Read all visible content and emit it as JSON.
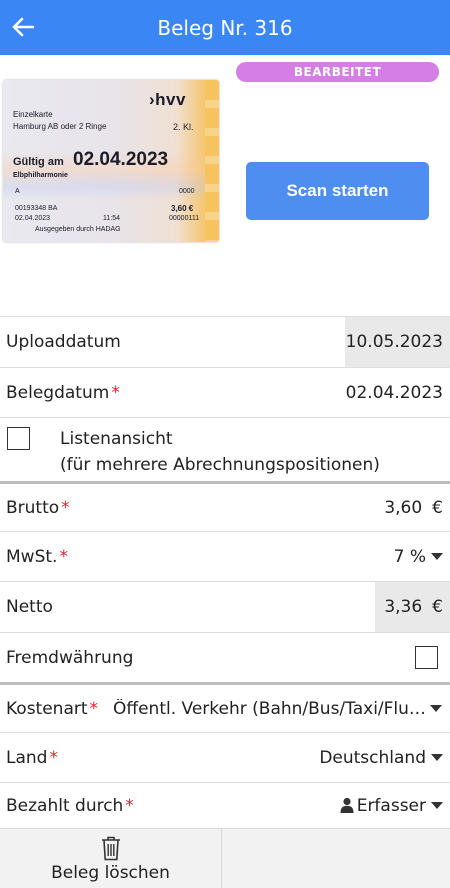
{
  "header": {
    "title": "Beleg Nr. 316",
    "back_icon": "arrow-left-icon"
  },
  "status_badge": {
    "label": "BEARBEITET",
    "color": "#d47ee6"
  },
  "ticket": {
    "logo": "›hvv",
    "line1": "Einzelkarte",
    "line2": "Hamburg AB oder 2 Ringe",
    "class": "2. Kl.",
    "valid_label": "Gültig am",
    "valid_date": "02.04.2023",
    "stop": "Elbphilharmonie",
    "a": "A",
    "zero": "0000",
    "number": "00193348  BA",
    "price": "3,60 €",
    "date": "02.04.2023",
    "time": "11:54",
    "counter": "00000111",
    "issued_by": "Ausgegeben durch HADAG"
  },
  "scan_button": {
    "label": "Scan starten",
    "color": "#4d8ef0"
  },
  "fields": {
    "upload_date": {
      "label": "Uploaddatum",
      "value": "10.05.2023"
    },
    "receipt_date": {
      "label": "Belegdatum",
      "required": "*",
      "value": "02.04.2023"
    },
    "list_view": {
      "label": "Listenansicht",
      "sublabel": "(für mehrere Abrechnungspositionen)",
      "checked": false
    },
    "gross": {
      "label": "Brutto",
      "required": "*",
      "value": "3,60",
      "currency": "€"
    },
    "vat": {
      "label": "MwSt.",
      "required": "*",
      "value": "7 %"
    },
    "net": {
      "label": "Netto",
      "value": "3,36",
      "currency": "€"
    },
    "foreign_currency": {
      "label": "Fremdwährung",
      "checked": false
    },
    "cost_type": {
      "label": "Kostenart",
      "required": "*",
      "value": "Öffentl. Verkehr (Bahn/Bus/Taxi/Flu…"
    },
    "country": {
      "label": "Land",
      "required": "*",
      "value": "Deutschland"
    },
    "paid_by": {
      "label": "Bezahlt durch",
      "required": "*",
      "value": "Erfasser",
      "icon": "user-icon"
    }
  },
  "bottom_bar": {
    "delete_label": "Beleg löschen",
    "delete_icon": "trash-icon"
  },
  "colors": {
    "header": "#3b86f5",
    "required": "#d9252f",
    "readonly_bg": "#e9e9e9"
  }
}
